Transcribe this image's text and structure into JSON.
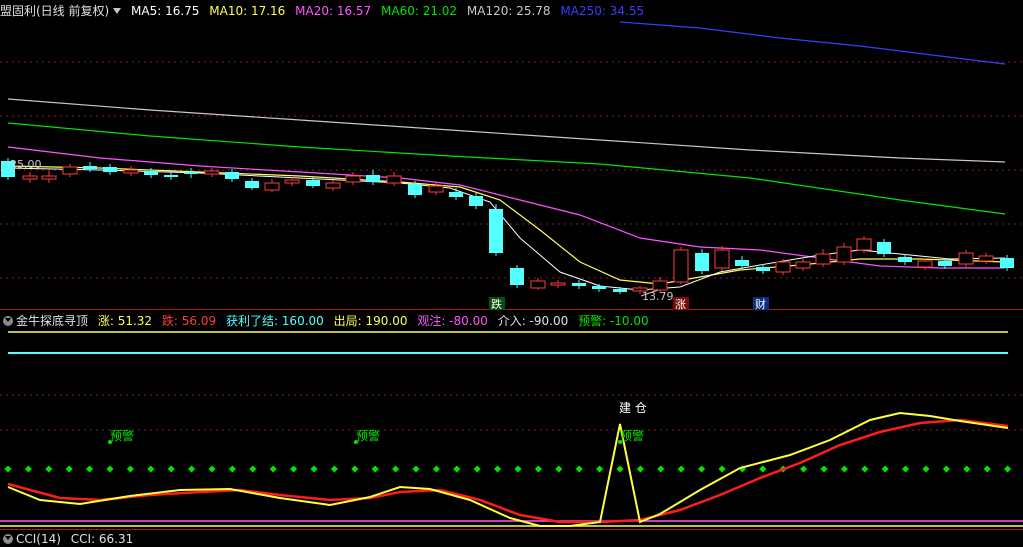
{
  "colors": {
    "up": "#ff3c3c",
    "down": "#54ffff",
    "ma5": "#ffffff",
    "ma10": "#ffff54",
    "ma20": "#ff54ff",
    "ma60": "#00e600",
    "ma120": "#c8c8c8",
    "ma250": "#3c3cff"
  },
  "kline": {
    "stock_name": "盟固利(日线 前复权)",
    "ma5": "MA5: 16.75",
    "ma10": "MA10: 17.16",
    "ma20": "MA20: 16.57",
    "ma60": "MA60: 21.02",
    "ma120": "MA120: 25.78",
    "ma250": "MA250: 34.55",
    "high_label": "25.00",
    "low_label": "13.79",
    "marker_fall": "跌",
    "marker_rise": "涨",
    "marker_fin": "财"
  },
  "indicator": {
    "name": "金牛探底寻顶",
    "zhang": "涨: 51.32",
    "die": "跌: 56.09",
    "huolijiao": "获利了结: 160.00",
    "chuju": "出局: 190.00",
    "guanzhu": "观注: -80.00",
    "jieru": "介入: -90.00",
    "yujing": "预警: -10.00",
    "warn_text": "预警",
    "build_text": "建 仓"
  },
  "cci": {
    "label": "CCI(14)",
    "value": "CCI: 66.31"
  }
}
